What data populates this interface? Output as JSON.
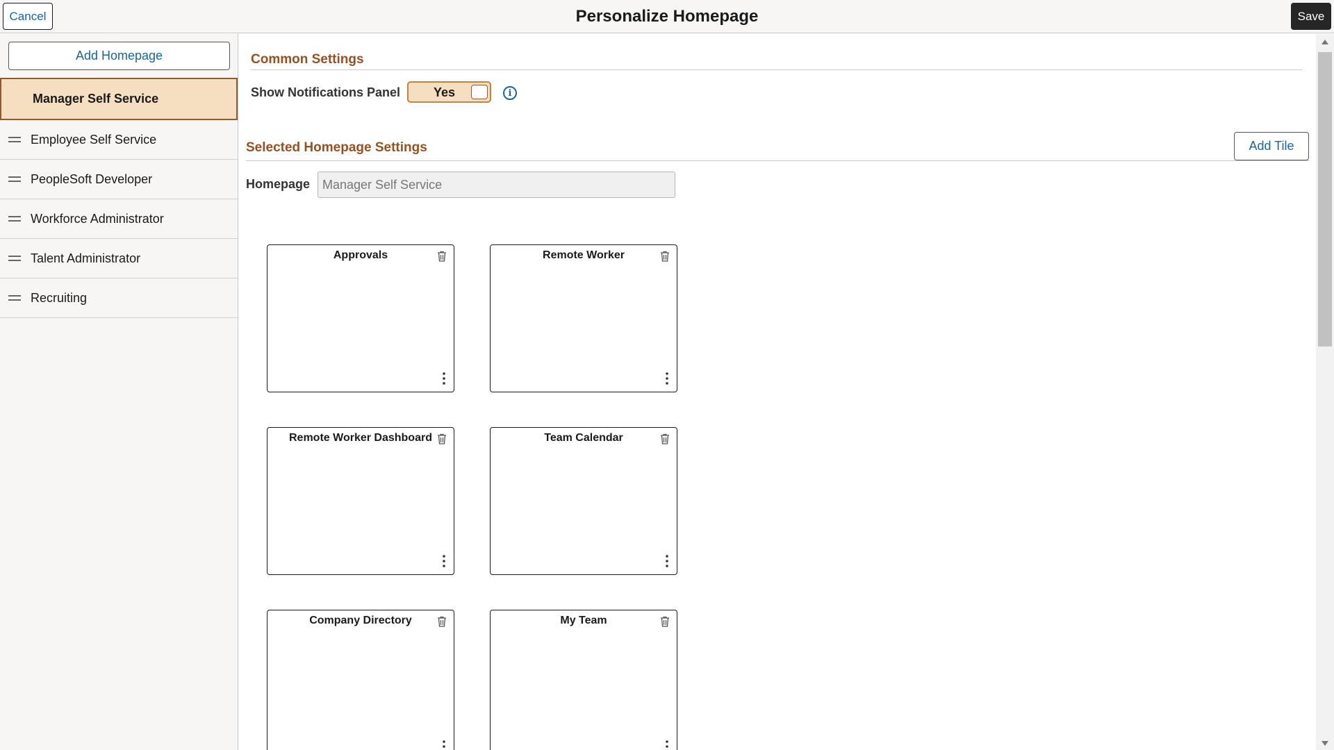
{
  "header": {
    "cancel_label": "Cancel",
    "title": "Personalize Homepage",
    "save_label": "Save"
  },
  "sidebar": {
    "add_homepage_label": "Add Homepage",
    "items": [
      {
        "label": "Manager Self Service",
        "selected": true
      },
      {
        "label": "Employee Self Service"
      },
      {
        "label": "PeopleSoft Developer"
      },
      {
        "label": "Workforce Administrator"
      },
      {
        "label": "Talent Administrator"
      },
      {
        "label": "Recruiting"
      }
    ]
  },
  "common_settings": {
    "title": "Common Settings",
    "notifications_label": "Show Notifications Panel",
    "notifications_value": "Yes",
    "info_icon": "i"
  },
  "selected_settings": {
    "title": "Selected Homepage Settings",
    "add_tile_label": "Add Tile",
    "homepage_label": "Homepage",
    "homepage_value": "Manager Self Service"
  },
  "tiles": [
    {
      "title": "Approvals"
    },
    {
      "title": "Remote Worker"
    },
    {
      "title": "Remote Worker Dashboard"
    },
    {
      "title": "Team Calendar"
    },
    {
      "title": "Company Directory"
    },
    {
      "title": "My Team"
    }
  ],
  "colors": {
    "accent": "#9a4f20",
    "link": "#1565a7",
    "selected_bg": "#f6dfc0"
  }
}
